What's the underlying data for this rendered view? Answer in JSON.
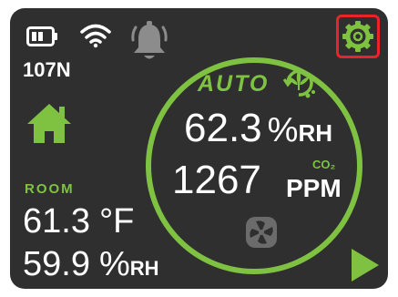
{
  "status": {
    "device_id": "107N"
  },
  "controller": {
    "mode": "AUTO",
    "humidity_value": "62.3",
    "humidity_pct": "%",
    "humidity_unit": "RH",
    "co2_value": "1267",
    "co2_label": "CO₂",
    "co2_unit": "PPM"
  },
  "room": {
    "label": "ROOM",
    "temperature": "61.3",
    "temperature_unit": "°F",
    "humidity": "59.9",
    "humidity_pct": "%",
    "humidity_unit": "RH"
  },
  "colors": {
    "background": "#2f2f2f",
    "accent": "#7fc241",
    "text": "#ffffff",
    "highlight_border": "#e8232a",
    "muted_icon": "#8c8c8c"
  },
  "icons": [
    "battery-icon",
    "wifi-icon",
    "bell-icon",
    "settings-gear-icon",
    "home-icon",
    "cannabis-leaf-icon",
    "fan-icon",
    "play-icon"
  ]
}
